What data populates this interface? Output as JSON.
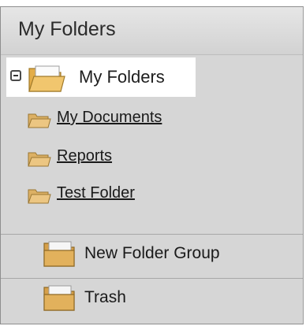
{
  "panel": {
    "title": "My Folders"
  },
  "tree": {
    "root": {
      "label": "My Folders",
      "expanded": true,
      "expander_icon": "collapse-minus-icon",
      "icon": "open-folder-icon"
    },
    "children": [
      {
        "label": "My Documents",
        "icon": "small-folder-icon"
      },
      {
        "label": "Reports",
        "icon": "small-folder-icon"
      },
      {
        "label": "Test Folder",
        "icon": "small-folder-icon"
      }
    ]
  },
  "groups": [
    {
      "label": "New Folder Group",
      "icon": "folder-icon"
    },
    {
      "label": "Trash",
      "icon": "folder-icon"
    }
  ],
  "colors": {
    "panel_background": "#d6d6d6",
    "selected_row": "#ffffff",
    "folder_fill": "#e8b95c",
    "folder_outline": "#a07a2a"
  }
}
